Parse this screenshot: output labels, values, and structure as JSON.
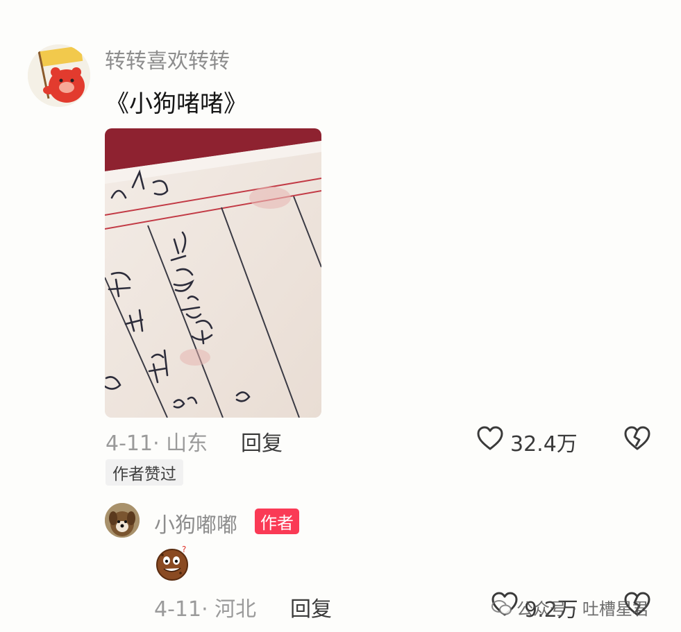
{
  "comment": {
    "username": "转转喜欢转转",
    "text": "《小狗啫啫》",
    "date_location": "4-11· 山东",
    "reply_label": "回复",
    "like_count": "32.4万",
    "author_liked_badge": "作者赞过"
  },
  "reply": {
    "username": "小狗嘟嘟",
    "author_badge": "作者",
    "date_location": "4-11· 河北",
    "reply_label": "回复",
    "like_count": "9.2万"
  },
  "watermark": {
    "text": "公众号 · 吐槽星君"
  },
  "icons": {
    "like": "heart-outline-icon",
    "dislike": "broken-heart-icon",
    "emoji": "cookie-face-emoji"
  },
  "colors": {
    "author_badge": "#fa3a55",
    "username": "#8d8d8d",
    "meta": "#9a9a9a",
    "text": "#151515"
  }
}
